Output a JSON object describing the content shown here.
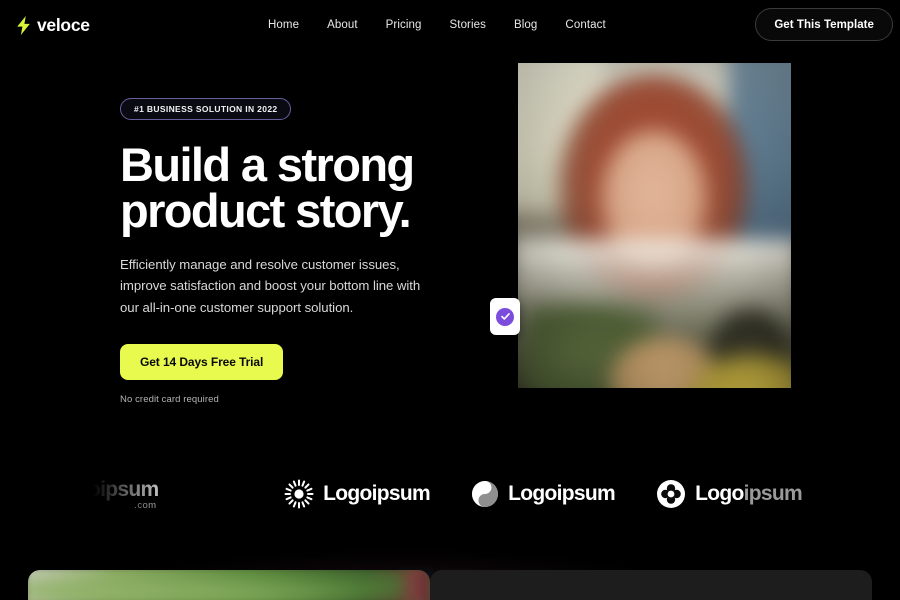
{
  "header": {
    "logo_text": "veloce",
    "logo_icon": "lightning-bolt-icon",
    "nav": [
      {
        "label": "Home"
      },
      {
        "label": "About"
      },
      {
        "label": "Pricing"
      },
      {
        "label": "Stories"
      },
      {
        "label": "Blog"
      },
      {
        "label": "Contact"
      }
    ],
    "cta_label": "Get This Template"
  },
  "hero": {
    "badge": "#1 BUSINESS SOLUTION IN 2022",
    "headline": "Build a strong product story.",
    "subhead": "Efficiently manage and resolve customer issues, improve satisfaction and boost your bottom line with our all-in-one customer support solution.",
    "cta_label": "Get 14 Days Free Trial",
    "cta_note": "No credit card required",
    "float_card_icon": "check-circle-icon"
  },
  "logos": {
    "items": [
      {
        "name": "logoipsum-dotcom",
        "mark": "none",
        "text_bold": "oipsum",
        "text_dim": "",
        "subtext": ".com"
      },
      {
        "name": "logoipsum-sunburst",
        "mark": "sunburst-icon",
        "text_bold": "Logoipsum",
        "text_dim": ""
      },
      {
        "name": "logoipsum-swirl",
        "mark": "swirl-icon",
        "text_bold": "Logoipsum",
        "text_dim": ""
      },
      {
        "name": "logoipsum-clover",
        "mark": "clover-icon",
        "text_bold": "Logo",
        "text_dim": "ipsum"
      }
    ]
  },
  "colors": {
    "background": "#000000",
    "accent_yellow": "#e8fa4e",
    "accent_purple": "#7c4ddd",
    "badge_border": "#6a5f9e",
    "text_primary": "#ffffff",
    "text_muted": "#b4b4b4",
    "card_dark": "#1d1d1d"
  }
}
